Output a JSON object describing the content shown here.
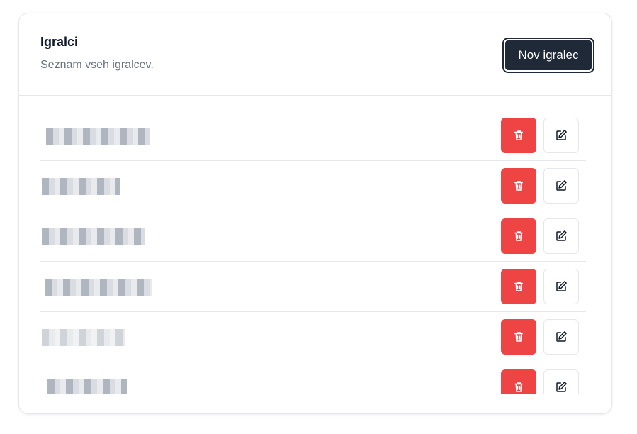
{
  "header": {
    "title": "Igralci",
    "subtitle": "Seznam vseh igralcev.",
    "new_button_label": "Nov igralec"
  },
  "players": [
    {
      "name": "",
      "delete_icon": "trash-icon",
      "edit_icon": "edit-icon"
    },
    {
      "name": "",
      "delete_icon": "trash-icon",
      "edit_icon": "edit-icon"
    },
    {
      "name": "",
      "delete_icon": "trash-icon",
      "edit_icon": "edit-icon"
    },
    {
      "name": "",
      "delete_icon": "trash-icon",
      "edit_icon": "edit-icon"
    },
    {
      "name": "",
      "delete_icon": "trash-icon",
      "edit_icon": "edit-icon"
    },
    {
      "name": "",
      "delete_icon": "trash-icon",
      "edit_icon": "edit-icon"
    }
  ],
  "colors": {
    "delete": "#ef4444",
    "primary_button": "#1f2937",
    "border": "#e5e7eb",
    "subtitle_text": "#6b7280"
  }
}
